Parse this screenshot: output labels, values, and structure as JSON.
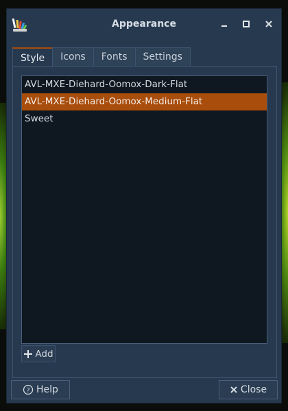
{
  "window": {
    "title": "Appearance"
  },
  "titlebar": {
    "minimize": "–",
    "maximize": "▫",
    "close": "✕"
  },
  "tabs": [
    {
      "label": "Style",
      "active": true
    },
    {
      "label": "Icons",
      "active": false
    },
    {
      "label": "Fonts",
      "active": false
    },
    {
      "label": "Settings",
      "active": false
    }
  ],
  "styles": [
    {
      "label": "AVL-MXE-Diehard-Oomox-Dark-Flat",
      "selected": false
    },
    {
      "label": "AVL-MXE-Diehard-Oomox-Medium-Flat",
      "selected": true
    },
    {
      "label": "Sweet",
      "selected": false
    }
  ],
  "add_button": {
    "label": "Add",
    "icon": "plus-icon"
  },
  "help_button": {
    "label": "Help",
    "icon": "help-circle-icon"
  },
  "close_button": {
    "label": "Close",
    "icon": "close-x-icon"
  },
  "colors": {
    "accent": "#a84d0c",
    "window_bg": "#27394f",
    "list_bg": "#0f1720"
  }
}
